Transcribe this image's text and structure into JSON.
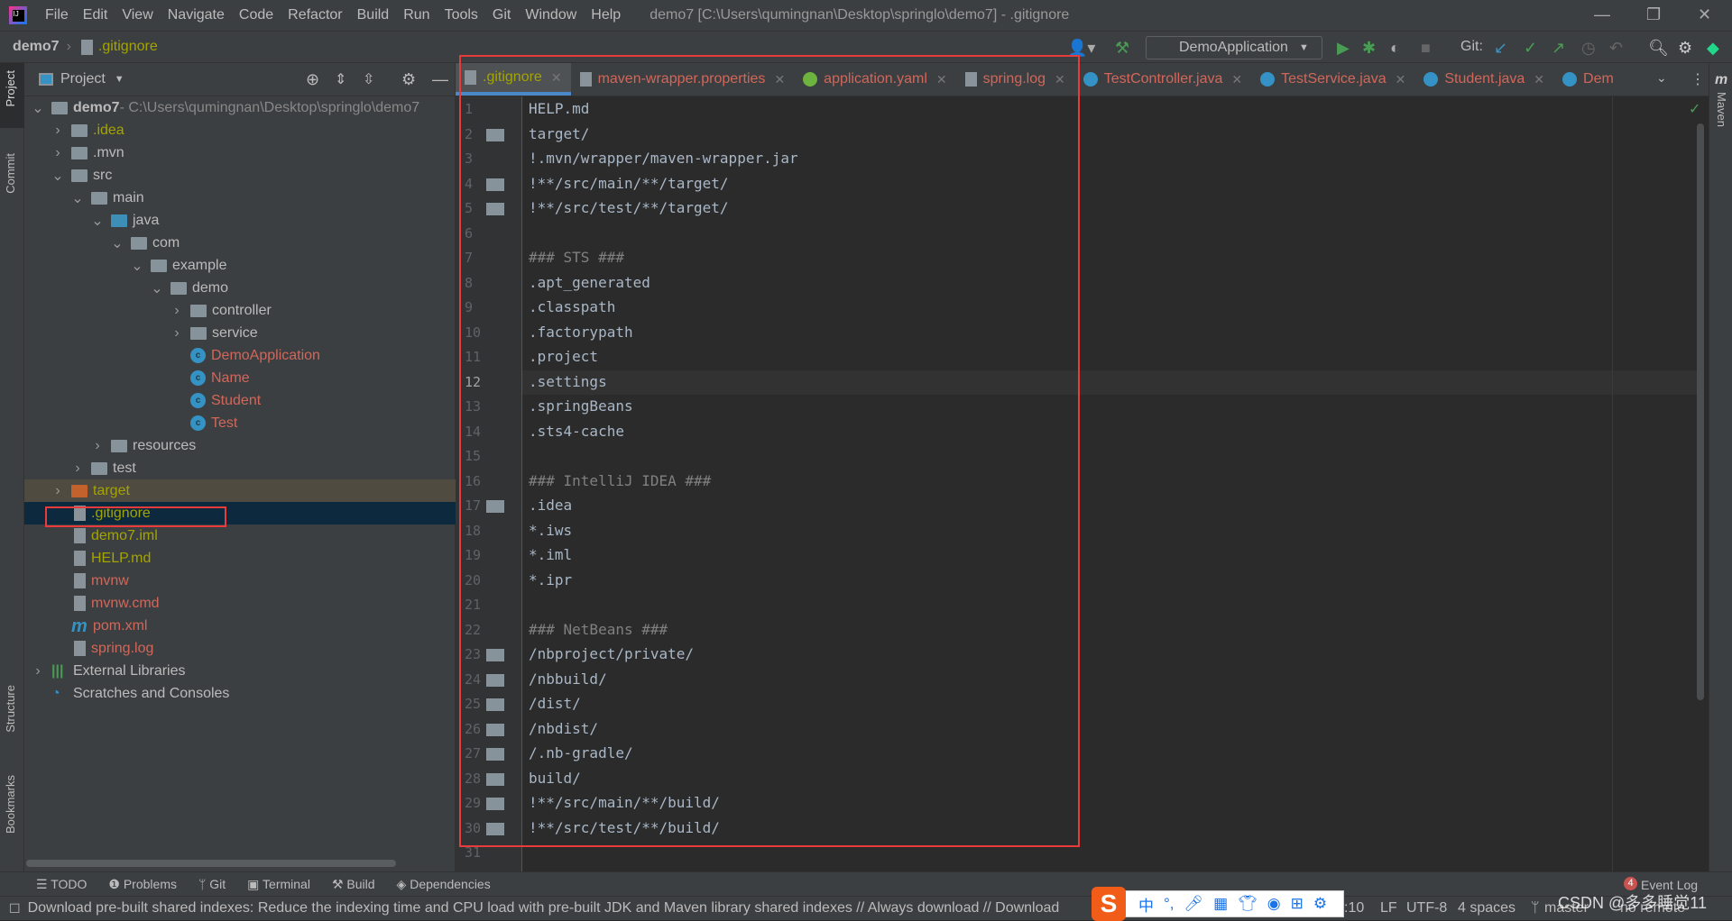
{
  "menubar": {
    "items": [
      "File",
      "Edit",
      "View",
      "Navigate",
      "Code",
      "Refactor",
      "Build",
      "Run",
      "Tools",
      "Git",
      "Window",
      "Help"
    ],
    "window_title": "demo7 [C:\\Users\\qumingnan\\Desktop\\springlo\\demo7] - .gitignore"
  },
  "navbar": {
    "project": "demo7",
    "file": ".gitignore",
    "run_config": "DemoApplication",
    "git_label": "Git:"
  },
  "project_panel": {
    "title": "Project",
    "tree": [
      {
        "label": "demo7",
        "extra": " - C:\\Users\\qumingnan\\Desktop\\springlo\\demo7",
        "level": 0,
        "chev": "v",
        "icon": "module",
        "color": "#bbbbbb",
        "bold": true
      },
      {
        "label": ".idea",
        "level": 1,
        "chev": ">",
        "icon": "folder",
        "color": "#a4a400"
      },
      {
        "label": ".mvn",
        "level": 1,
        "chev": ">",
        "icon": "folder",
        "color": "#bbbbbb"
      },
      {
        "label": "src",
        "level": 1,
        "chev": "v",
        "icon": "folder",
        "color": "#bbbbbb"
      },
      {
        "label": "main",
        "level": 2,
        "chev": "v",
        "icon": "folder",
        "color": "#bbbbbb"
      },
      {
        "label": "java",
        "level": 3,
        "chev": "v",
        "icon": "folder-blue",
        "color": "#bbbbbb"
      },
      {
        "label": "com",
        "level": 4,
        "chev": "v",
        "icon": "package",
        "color": "#bbbbbb"
      },
      {
        "label": "example",
        "level": 5,
        "chev": "v",
        "icon": "package",
        "color": "#bbbbbb"
      },
      {
        "label": "demo",
        "level": 6,
        "chev": "v",
        "icon": "package",
        "color": "#bbbbbb"
      },
      {
        "label": "controller",
        "level": 7,
        "chev": ">",
        "icon": "package",
        "color": "#bbbbbb"
      },
      {
        "label": "service",
        "level": 7,
        "chev": ">",
        "icon": "package",
        "color": "#bbbbbb"
      },
      {
        "label": "DemoApplication",
        "level": 7,
        "chev": "",
        "icon": "class",
        "color": "#d1675a"
      },
      {
        "label": "Name",
        "level": 7,
        "chev": "",
        "icon": "class",
        "color": "#d1675a"
      },
      {
        "label": "Student",
        "level": 7,
        "chev": "",
        "icon": "class",
        "color": "#d1675a"
      },
      {
        "label": "Test",
        "level": 7,
        "chev": "",
        "icon": "class",
        "color": "#d1675a"
      },
      {
        "label": "resources",
        "level": 3,
        "chev": ">",
        "icon": "folder",
        "color": "#bbbbbb"
      },
      {
        "label": "test",
        "level": 2,
        "chev": ">",
        "icon": "folder",
        "color": "#bbbbbb"
      },
      {
        "label": "target",
        "level": 1,
        "chev": ">",
        "icon": "folder-orange",
        "color": "#a4a400",
        "highlight": "#4f4b41"
      },
      {
        "label": ".gitignore",
        "level": 1,
        "chev": "",
        "icon": "file",
        "color": "#a4a400",
        "selected": true
      },
      {
        "label": "demo7.iml",
        "level": 1,
        "chev": "",
        "icon": "file",
        "color": "#a4a400"
      },
      {
        "label": "HELP.md",
        "level": 1,
        "chev": "",
        "icon": "file",
        "color": "#a4a400"
      },
      {
        "label": "mvnw",
        "level": 1,
        "chev": "",
        "icon": "file",
        "color": "#d1675a"
      },
      {
        "label": "mvnw.cmd",
        "level": 1,
        "chev": "",
        "icon": "file",
        "color": "#d1675a"
      },
      {
        "label": "pom.xml",
        "level": 1,
        "chev": "",
        "icon": "maven",
        "color": "#d1675a"
      },
      {
        "label": "spring.log",
        "level": 1,
        "chev": "",
        "icon": "file",
        "color": "#d1675a"
      },
      {
        "label": "External Libraries",
        "level": 0,
        "chev": ">",
        "icon": "libraries",
        "color": "#bbbbbb"
      },
      {
        "label": "Scratches and Consoles",
        "level": 0,
        "chev": "",
        "icon": "scratches",
        "color": "#bbbbbb"
      }
    ]
  },
  "tabs": [
    {
      "label": ".gitignore",
      "color": "#a4a400",
      "active": true
    },
    {
      "label": "maven-wrapper.properties",
      "color": "#d1675a"
    },
    {
      "label": "application.yaml",
      "color": "#d1675a"
    },
    {
      "label": "spring.log",
      "color": "#d1675a"
    },
    {
      "label": "TestController.java",
      "color": "#d1675a"
    },
    {
      "label": "TestService.java",
      "color": "#d1675a"
    },
    {
      "label": "Student.java",
      "color": "#d1675a"
    },
    {
      "label": "Dem",
      "color": "#d1675a"
    }
  ],
  "editor": {
    "current_line": 12,
    "lines": [
      "HELP.md",
      "target/",
      "!.mvn/wrapper/maven-wrapper.jar",
      "!**/src/main/**/target/",
      "!**/src/test/**/target/",
      "",
      "### STS ###",
      ".apt_generated",
      ".classpath",
      ".factorypath",
      ".project",
      ".settings",
      ".springBeans",
      ".sts4-cache",
      "",
      "### IntelliJ IDEA ###",
      ".idea",
      "*.iws",
      "*.iml",
      "*.ipr",
      "",
      "### NetBeans ###",
      "/nbproject/private/",
      "/nbbuild/",
      "/dist/",
      "/nbdist/",
      "/.nb-gradle/",
      "build/",
      "!**/src/main/**/build/",
      "!**/src/test/**/build/",
      ""
    ],
    "folder_lines": [
      2,
      4,
      5,
      17,
      23,
      24,
      25,
      26,
      27,
      28,
      29,
      30
    ]
  },
  "side_stripes": {
    "left": [
      "Project",
      "Commit",
      "Structure",
      "Bookmarks"
    ],
    "right": [
      "Maven"
    ]
  },
  "bottom_tools": [
    "TODO",
    "Problems",
    "Git",
    "Terminal",
    "Build",
    "Dependencies"
  ],
  "event_log": {
    "count": "4",
    "label": "Event Log"
  },
  "status": {
    "message": "Download pre-built shared indexes: Reduce the indexing time and CPU load with pre-built JDK and Maven library shared indexes // Always download // Download",
    "position": ":10",
    "line_sep": "LF",
    "encoding": "UTF-8",
    "indent": "4 spaces",
    "branch": "master",
    "remote": "no remote"
  },
  "ime": {
    "mode": "中",
    "punct": "°,"
  },
  "watermark": "CSDN @多多睡觉11",
  "colors": {
    "annotation": "#e83b3b",
    "accent": "#4a88c7"
  }
}
